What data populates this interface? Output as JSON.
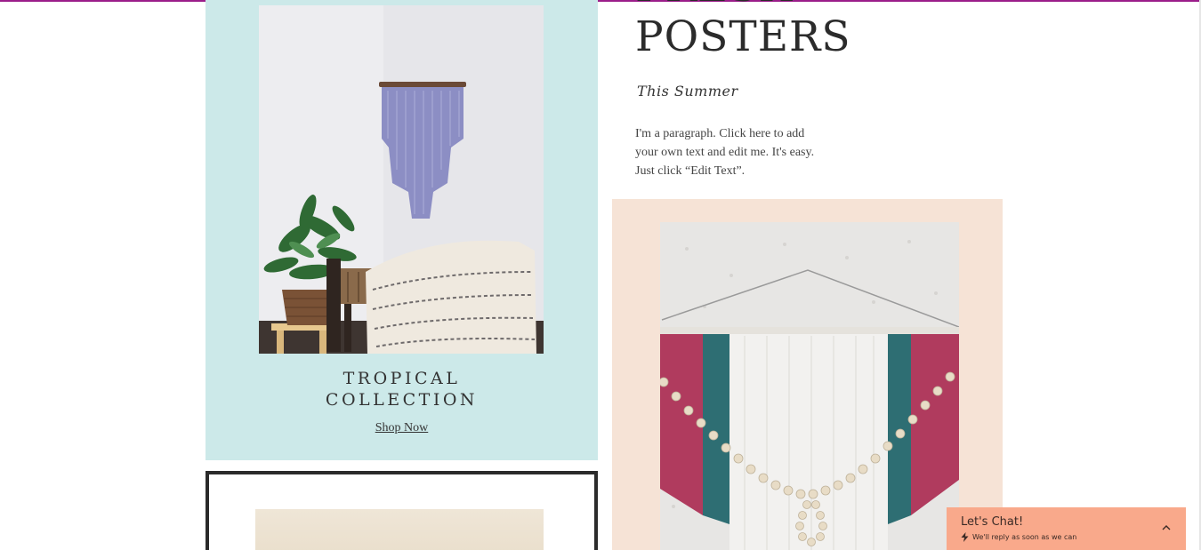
{
  "headline": "FRESH\nPOSTERS",
  "subtitle": "This Summer",
  "paragraph": "I'm a paragraph. Click here to add your own text and edit me. It's easy. Just click “Edit Text”.",
  "tropical_card": {
    "title": "TROPICAL\nCOLLECTION",
    "link_label": "Shop Now",
    "background": "#cce9e9"
  },
  "peach_card": {
    "background": "#f6e3d6"
  },
  "chat_widget": {
    "title": "Let's Chat!",
    "subtitle": "We'll reply as soon as we can",
    "background": "#f9a98b",
    "icons": [
      "bolt-icon",
      "chevron-up-icon"
    ]
  },
  "colors": {
    "top_accent": "#9b1d8a",
    "text": "#2b2b2b"
  }
}
